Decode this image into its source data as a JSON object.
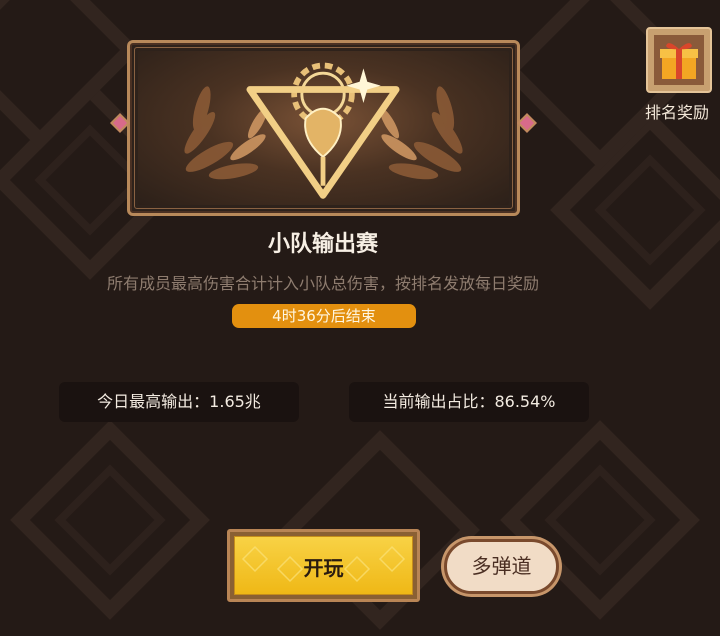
{
  "event": {
    "title": "小队输出赛",
    "description": "所有成员最高伤害合计计入小队总伤害，按排名发放每日奖励",
    "timer": "4时36分后结束"
  },
  "ranking_reward": {
    "label": "排名奖励",
    "icon": "gift-box-icon"
  },
  "stats": {
    "today_best": "今日最高输出：1.65兆",
    "current_share": "当前输出占比：86.54%"
  },
  "buttons": {
    "play": "开玩",
    "multi_lane": "多弹道"
  },
  "colors": {
    "background": "#241a16",
    "timer_badge": "#e3900f",
    "play_button": "#f5c52c",
    "frame_gold": "#b8895a"
  }
}
